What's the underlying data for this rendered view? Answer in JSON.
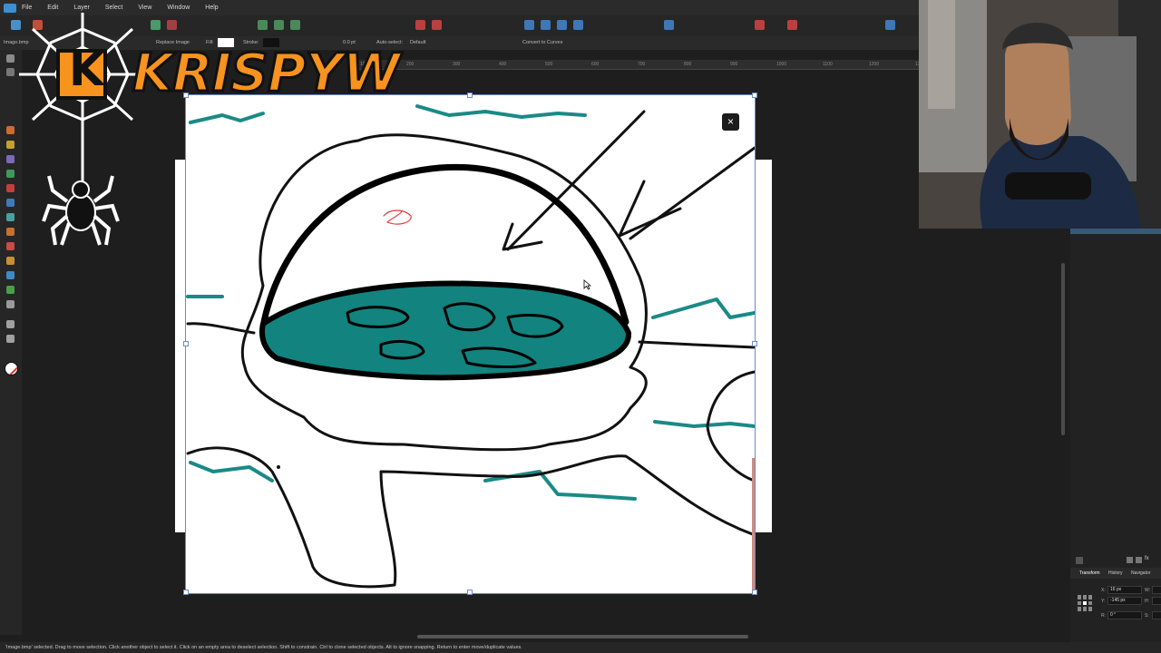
{
  "menu": {
    "items": [
      "File",
      "Edit",
      "Layer",
      "Select",
      "View",
      "Window",
      "Help"
    ]
  },
  "document": {
    "tab_label": "Image.bmp"
  },
  "context_toolbar": {
    "replace_image": "Replace Image",
    "fill_label": "Fill:",
    "stroke_label": "Stroke:",
    "stroke_width": "0.0 pt",
    "auto_select_label": "Auto-select:",
    "auto_select_value": "Default",
    "convert_to_curves": "Convert to Curves"
  },
  "ruler": {
    "ticks": [
      "100",
      "200",
      "300",
      "400",
      "500",
      "600",
      "700",
      "800",
      "900",
      "1000",
      "1100",
      "1200",
      "1300",
      "1400",
      "1500",
      "1600"
    ]
  },
  "overlay": {
    "logo_text": "KRISPYW",
    "logo_letter": "K"
  },
  "status": {
    "message": "'Image.bmp' selected. Drag to move selection. Click another object to select it. Click on an empty area to deselect selection. Shift to constrain. Ctrl to clone selected objects. Alt to ignore snapping. Return to enter move/duplicate values."
  },
  "right_panel": {
    "tabs": [
      "Transform",
      "History",
      "Navigator"
    ],
    "fx_label": "fx",
    "transform": {
      "x_label": "X:",
      "x_value": "16 px",
      "y_label": "Y:",
      "y_value": "-145 px",
      "r_label": "R:",
      "r_value": "0 °",
      "w_label": "W:",
      "h_label": "H:",
      "s_label": "S:"
    }
  },
  "dialog": {
    "close_glyph": "×"
  },
  "colors": {
    "accent": "#3a8fd6",
    "teal_fill": "#12837f",
    "teal_stroke": "#1a8a86",
    "logo_orange": "#f7931e",
    "selection": "#6c8bc4"
  }
}
